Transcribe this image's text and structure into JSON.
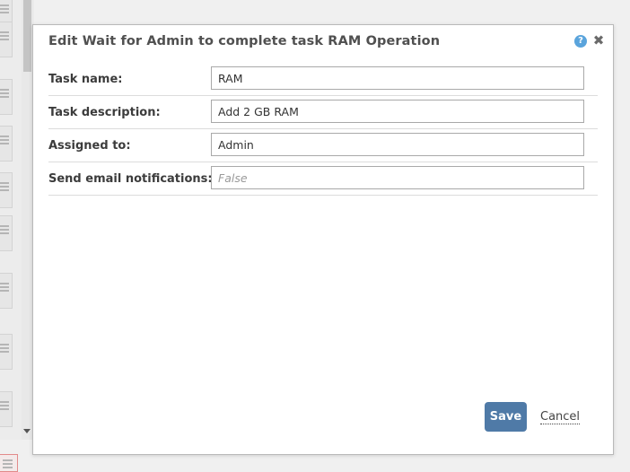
{
  "dialog": {
    "title": "Edit Wait for Admin to complete task RAM Operation",
    "help_icon": "?",
    "close_icon": "✖",
    "help_icon_color": "#5aa4dc"
  },
  "form": {
    "fields": [
      {
        "label": "Task name:",
        "value": "RAM",
        "placeholder": ""
      },
      {
        "label": "Task description:",
        "value": "Add 2 GB RAM",
        "placeholder": ""
      },
      {
        "label": "Assigned to:",
        "value": "Admin",
        "placeholder": ""
      },
      {
        "label": "Send email notifications:",
        "value": "",
        "placeholder": "False"
      }
    ]
  },
  "actions": {
    "save_label": "Save",
    "cancel_label": "Cancel",
    "save_color": "#4f7aa7"
  }
}
